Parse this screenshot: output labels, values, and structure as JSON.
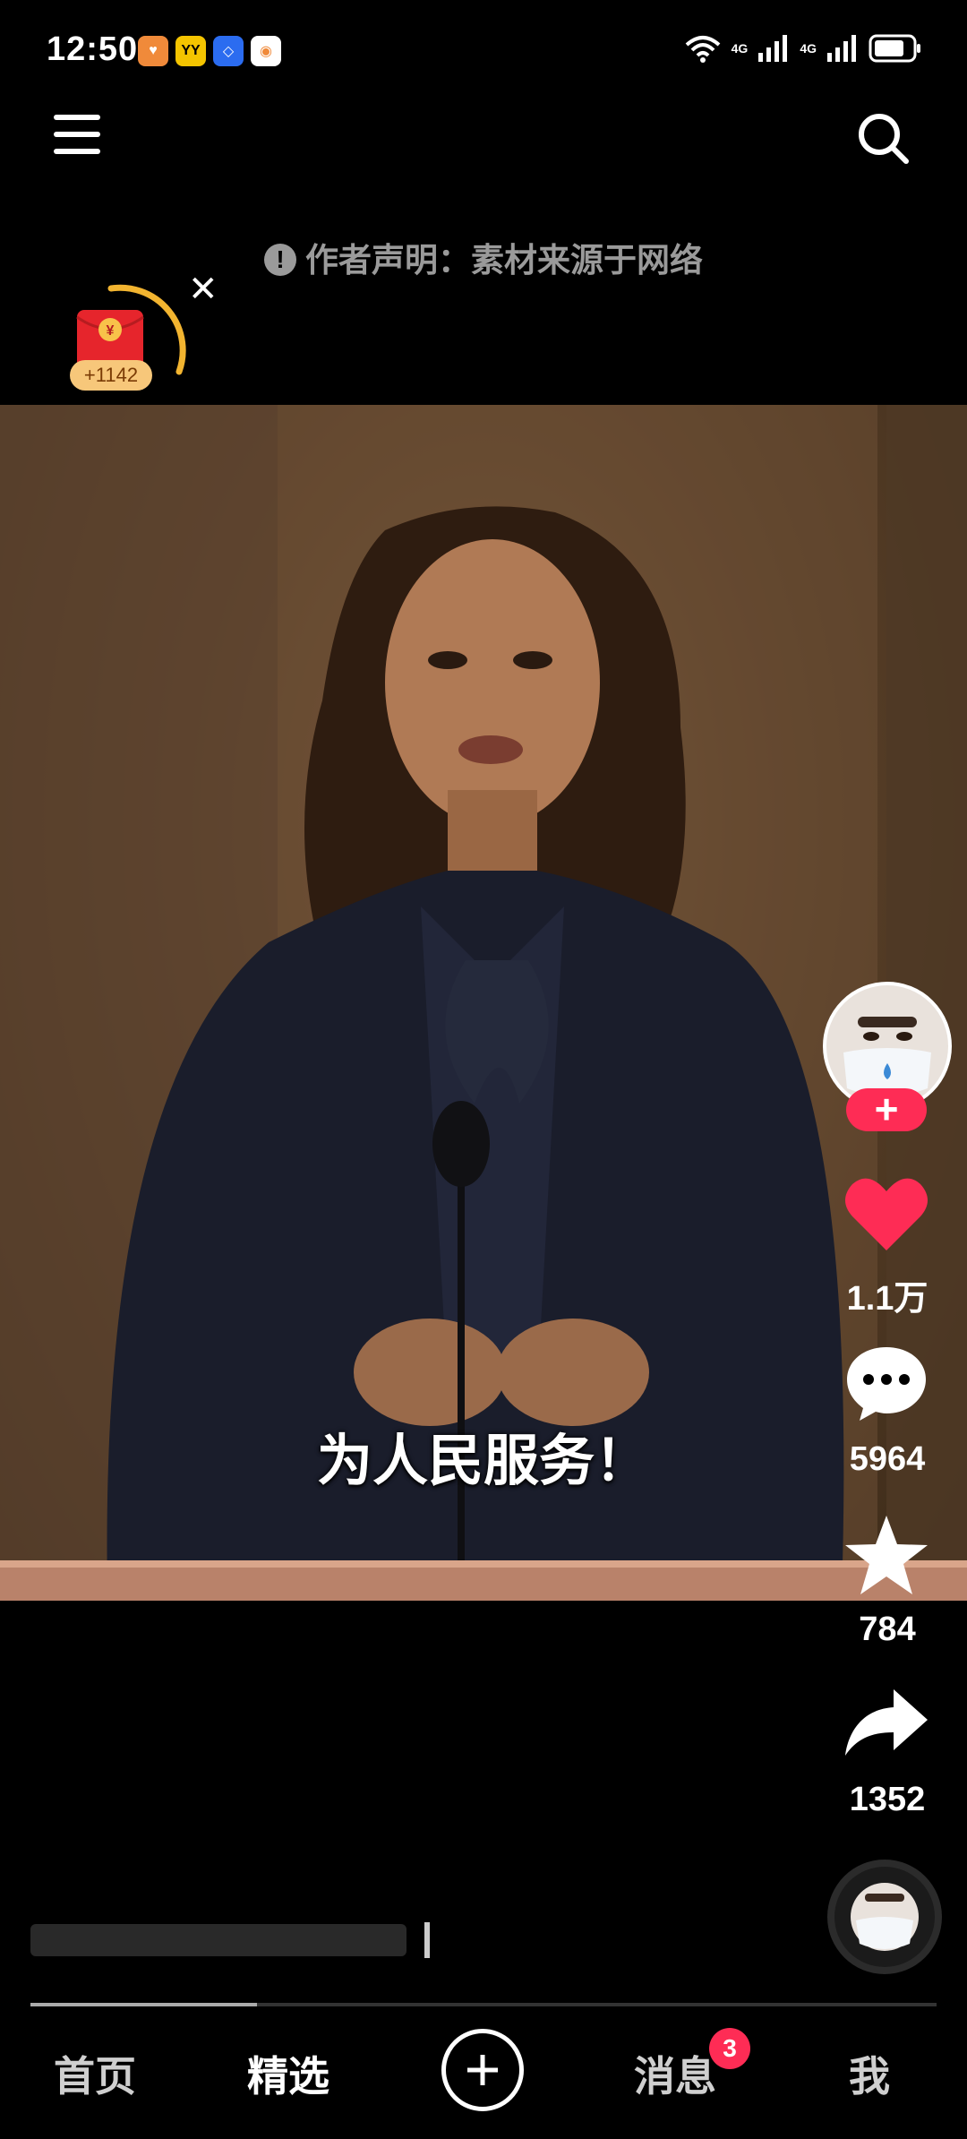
{
  "status_bar": {
    "time": "12:50",
    "app_badges": [
      {
        "icon": "heart-app-icon",
        "color": "#f08a3a",
        "glyph": "♥"
      },
      {
        "icon": "yy-app-icon",
        "color": "#f4c400",
        "glyph": "YY"
      },
      {
        "icon": "blue-app-icon",
        "color": "#2b6cf0",
        "glyph": "◇"
      },
      {
        "icon": "browser-app-icon",
        "color": "#ffffff",
        "glyph": "◉"
      }
    ],
    "network_labels": [
      "4G",
      "4G"
    ]
  },
  "header": {
    "notice_text": "作者声明：素材来源于网络"
  },
  "red_packet": {
    "amount": "+1142",
    "symbol": "¥"
  },
  "video": {
    "subtitle": "为人民服务！"
  },
  "actions": {
    "likes": "1.1万",
    "comments": "5964",
    "favorites": "784",
    "shares": "1352"
  },
  "playback": {
    "progress_fraction": 0.25
  },
  "nav": {
    "home": "首页",
    "featured": "精选",
    "messages": "消息",
    "messages_badge": "3",
    "me": "我"
  },
  "colors": {
    "accent": "#fe2c55",
    "background": "#000000"
  }
}
